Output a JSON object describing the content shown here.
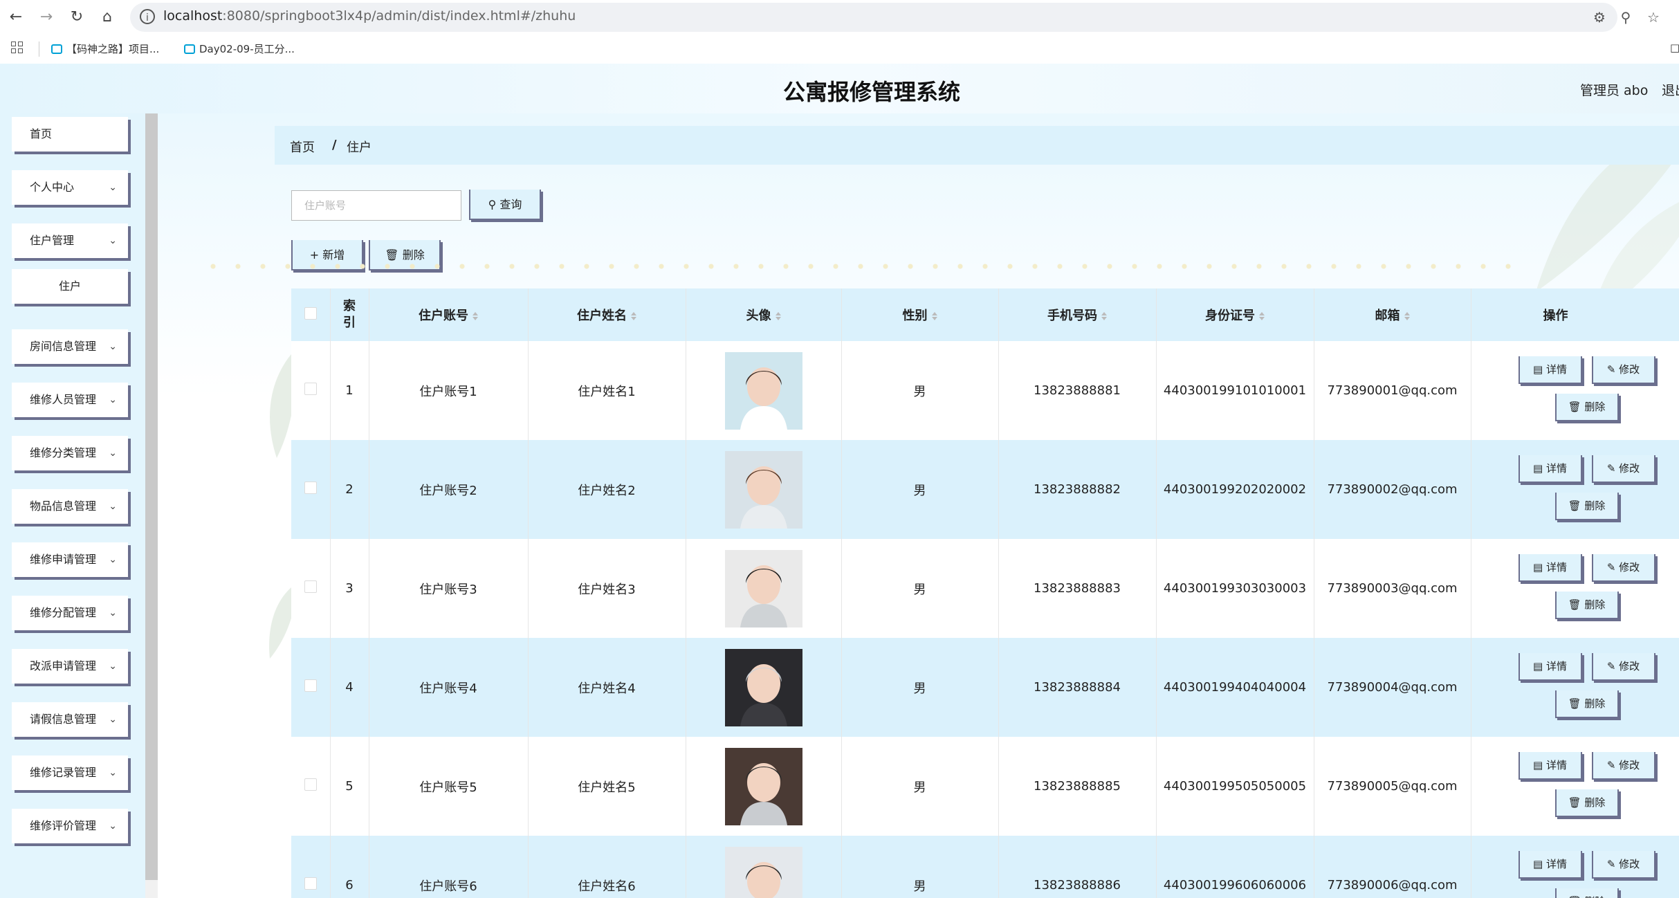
{
  "browser": {
    "url_host": "localhost",
    "url_rest": ":8080/springboot3lx4p/admin/dist/index.html#/zhuhu",
    "bookmarks": [
      "【码神之路】项目...",
      "Day02-09-员工分..."
    ]
  },
  "app": {
    "title": "公寓报修管理系统",
    "user": "管理员 abo",
    "logout": "退出"
  },
  "sidebar": {
    "items": [
      {
        "label": "首页",
        "has_chevron": false
      },
      {
        "label": "个人中心",
        "has_chevron": true
      },
      {
        "label": "住户管理",
        "has_chevron": true
      },
      {
        "label": "住户",
        "has_chevron": false,
        "sub": true
      },
      {
        "label": "房间信息管理",
        "has_chevron": true
      },
      {
        "label": "维修人员管理",
        "has_chevron": true
      },
      {
        "label": "维修分类管理",
        "has_chevron": true
      },
      {
        "label": "物品信息管理",
        "has_chevron": true
      },
      {
        "label": "维修申请管理",
        "has_chevron": true
      },
      {
        "label": "维修分配管理",
        "has_chevron": true
      },
      {
        "label": "改派申请管理",
        "has_chevron": true
      },
      {
        "label": "请假信息管理",
        "has_chevron": true
      },
      {
        "label": "维修记录管理",
        "has_chevron": true
      },
      {
        "label": "维修评价管理",
        "has_chevron": true
      }
    ]
  },
  "breadcrumb": {
    "home": "首页",
    "separator": "/",
    "current": "住户"
  },
  "search": {
    "placeholder": "住户账号",
    "button": "查询"
  },
  "toolbar": {
    "add": "新增",
    "delete": "删除"
  },
  "table": {
    "headers": [
      "索引",
      "住户账号",
      "住户姓名",
      "头像",
      "性别",
      "手机号码",
      "身份证号",
      "邮箱",
      "操作"
    ],
    "rows": [
      {
        "index": "1",
        "account": "住户账号1",
        "name": "住户姓名1",
        "gender": "男",
        "phone": "13823888881",
        "id_card": "440300199101010001",
        "email": "773890001@qq.com"
      },
      {
        "index": "2",
        "account": "住户账号2",
        "name": "住户姓名2",
        "gender": "男",
        "phone": "13823888882",
        "id_card": "440300199202020002",
        "email": "773890002@qq.com"
      },
      {
        "index": "3",
        "account": "住户账号3",
        "name": "住户姓名3",
        "gender": "男",
        "phone": "13823888883",
        "id_card": "440300199303030003",
        "email": "773890003@qq.com"
      },
      {
        "index": "4",
        "account": "住户账号4",
        "name": "住户姓名4",
        "gender": "男",
        "phone": "13823888884",
        "id_card": "440300199404040004",
        "email": "773890004@qq.com"
      },
      {
        "index": "5",
        "account": "住户账号5",
        "name": "住户姓名5",
        "gender": "男",
        "phone": "13823888885",
        "id_card": "440300199505050005",
        "email": "773890005@qq.com"
      },
      {
        "index": "6",
        "account": "住户账号6",
        "name": "住户姓名6",
        "gender": "男",
        "phone": "13823888886",
        "id_card": "440300199606060006",
        "email": "773890006@qq.com"
      }
    ],
    "actions": {
      "detail": "详情",
      "edit": "修改",
      "delete": "删除"
    }
  }
}
